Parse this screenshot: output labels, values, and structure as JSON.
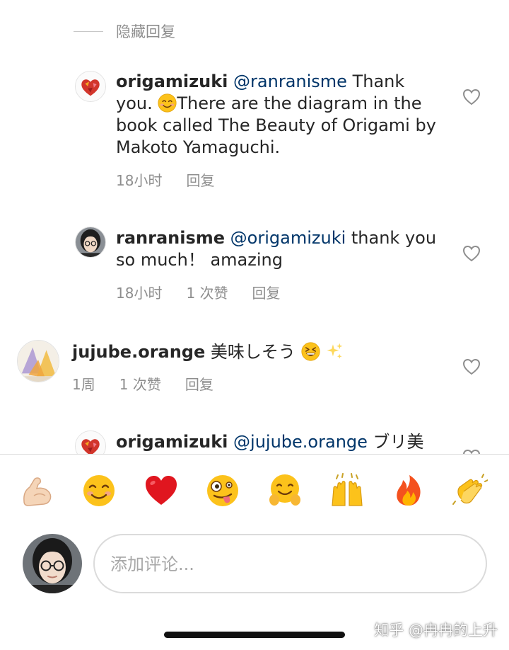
{
  "hide_replies_label": "隐藏回复",
  "comments": [
    {
      "username": "origamizuki",
      "mention": "@ranranisme",
      "text_before_emoji": " Thank you.",
      "emoji": "smiling-face-icon",
      "text_after_emoji": "There are the diagram in the book called The Beauty of Origami by Makoto Yamaguchi.",
      "time": "18小时",
      "reply_label": "回复"
    },
    {
      "username": "ranranisme",
      "mention": "@origamizuki",
      "text": " thank you so much！ amazing",
      "time": "18小时",
      "likes": "1 次赞",
      "reply_label": "回复"
    },
    {
      "username": "jujube.orange",
      "text": " 美味しそう",
      "emojis": [
        "grinning-squinting-face-icon",
        "sparkles-icon"
      ],
      "time": "1周",
      "likes": "1 次赞",
      "reply_label": "回复"
    },
    {
      "username": "origamizuki",
      "mention": "@jujube.orange",
      "text": " ブリ美"
    }
  ],
  "quick_emojis": [
    "flexed-biceps-icon",
    "smiling-face-icon",
    "red-heart-icon",
    "zany-face-icon",
    "hugging-face-icon",
    "raising-hands-icon",
    "fire-icon",
    "clapping-hands-icon"
  ],
  "composer": {
    "placeholder": "添加评论..."
  },
  "watermark": "知乎 @冉冉的上升",
  "colors": {
    "text": "#262626",
    "secondary": "#8e8e8e",
    "mention": "#003569",
    "divider": "#dbdbdb"
  }
}
